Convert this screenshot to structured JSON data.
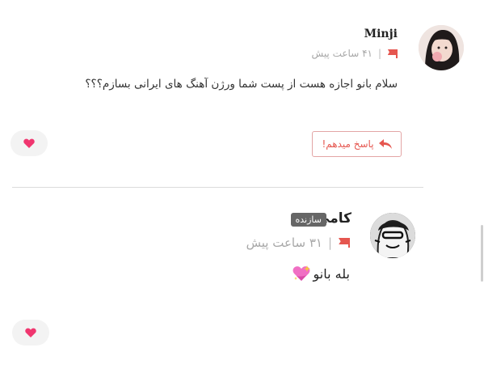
{
  "comments": [
    {
      "username": "Minji",
      "time": "۴۱ ساعت پیش",
      "separator": "|",
      "text": "سلام بانو اجازه هست از پست شما ورژن آهنگ های ایرانی بسازم؟؟؟",
      "reply_label": "پاسخ میدهم!",
      "icons": {
        "report": "flag-icon",
        "reply": "reply-icon",
        "like": "heart-icon"
      },
      "colors": {
        "accent": "#e5564f",
        "like": "#f0366f"
      }
    },
    {
      "username": "کامی",
      "badge": "سازنده",
      "time": "۳۱ ساعت پیش",
      "separator": "|",
      "text": "بله بانو",
      "emoji": "sparkling-heart",
      "icons": {
        "report": "flag-icon",
        "like": "heart-icon"
      }
    }
  ]
}
